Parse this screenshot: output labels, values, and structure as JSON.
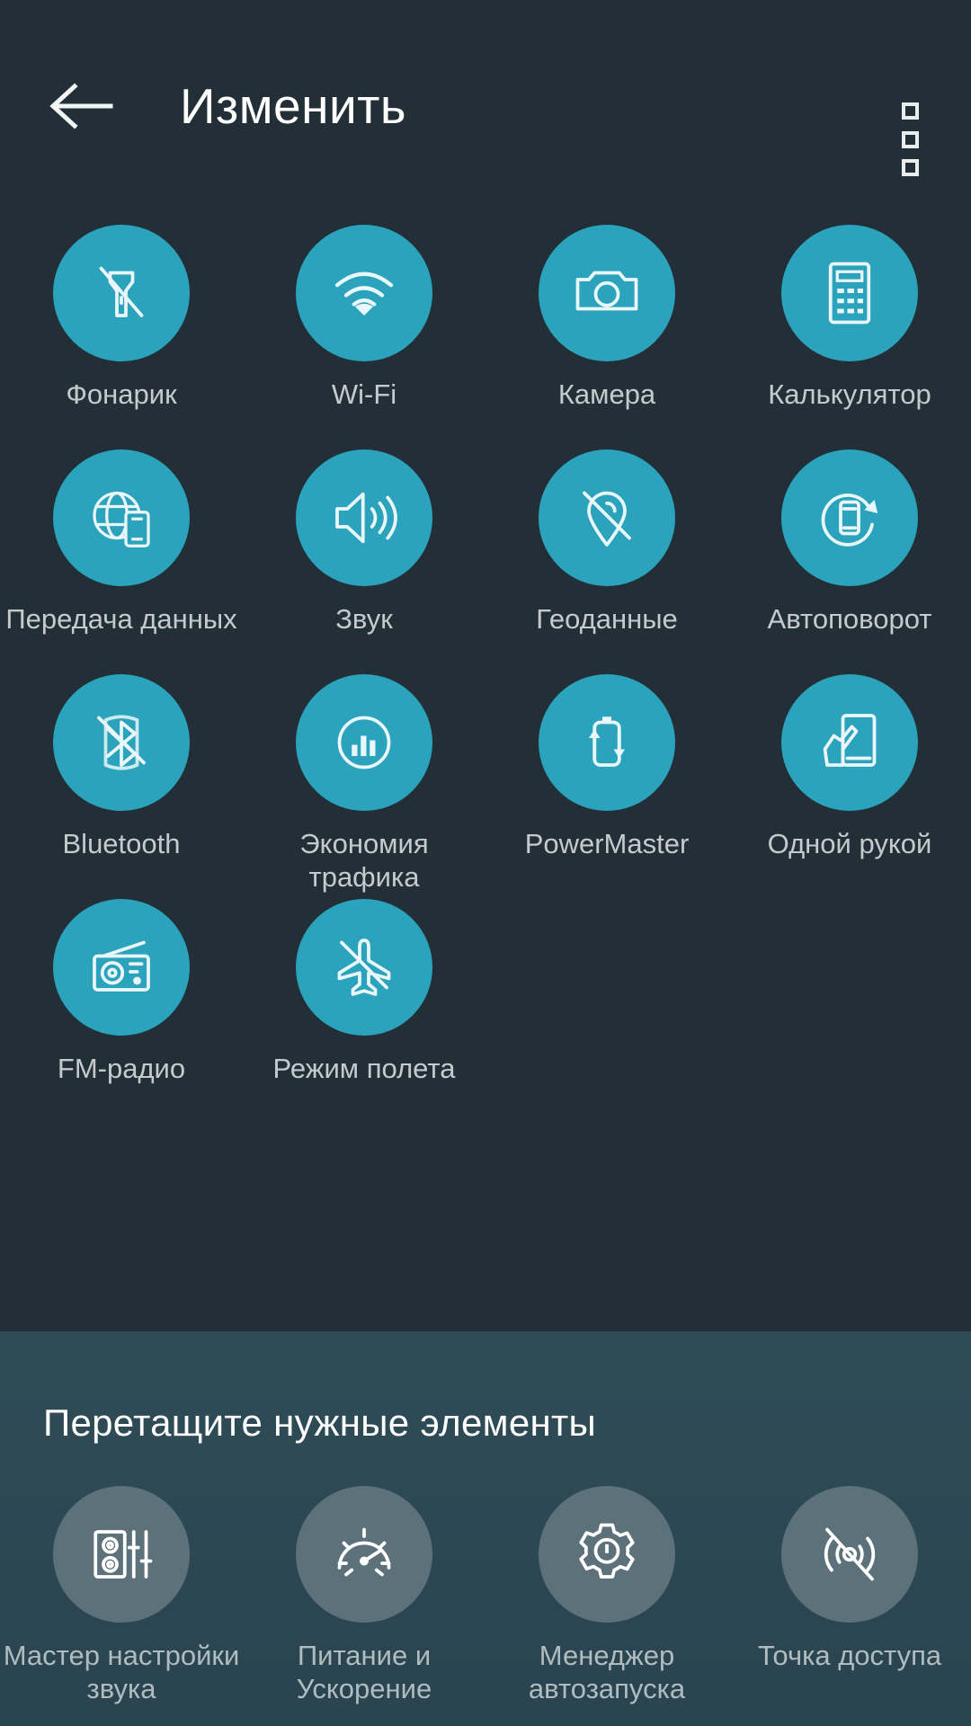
{
  "header": {
    "title": "Изменить",
    "back_icon": "arrow-left-icon",
    "overflow_icon": "overflow-menu-icon"
  },
  "colors": {
    "background": "#232F37",
    "tile_active": "#2BA3BC",
    "tile_inactive": "#5D717A",
    "panel": "#2E4C57",
    "label": "#C5CACD",
    "title": "#FFFFFF"
  },
  "active_tiles": [
    {
      "label": "Фонарик",
      "icon": "flashlight-off-icon"
    },
    {
      "label": "Wi-Fi",
      "icon": "wifi-icon"
    },
    {
      "label": "Камера",
      "icon": "camera-icon"
    },
    {
      "label": "Калькулятор",
      "icon": "calculator-icon"
    },
    {
      "label": "Передача данных",
      "icon": "mobile-data-icon"
    },
    {
      "label": "Звук",
      "icon": "sound-icon"
    },
    {
      "label": "Геоданные",
      "icon": "location-off-icon"
    },
    {
      "label": "Автоповорот",
      "icon": "auto-rotate-icon"
    },
    {
      "label": "Bluetooth",
      "icon": "bluetooth-off-icon"
    },
    {
      "label": "Экономия трафика",
      "icon": "data-saver-icon"
    },
    {
      "label": "PowerMaster",
      "icon": "power-master-icon"
    },
    {
      "label": "Одной рукой",
      "icon": "one-handed-icon"
    },
    {
      "label": "FM-радио",
      "icon": "fm-radio-icon"
    },
    {
      "label": "Режим полета",
      "icon": "airplane-off-icon"
    }
  ],
  "panel": {
    "hint": "Перетащите нужные элементы",
    "tiles": [
      {
        "label": "Мастер настройки звука",
        "icon": "audio-wizard-icon"
      },
      {
        "label": "Питание и Ускорение",
        "icon": "speedometer-icon"
      },
      {
        "label": "Менеджер автозапуска",
        "icon": "auto-start-manager-icon"
      },
      {
        "label": "Точка доступа",
        "icon": "hotspot-off-icon"
      }
    ]
  }
}
